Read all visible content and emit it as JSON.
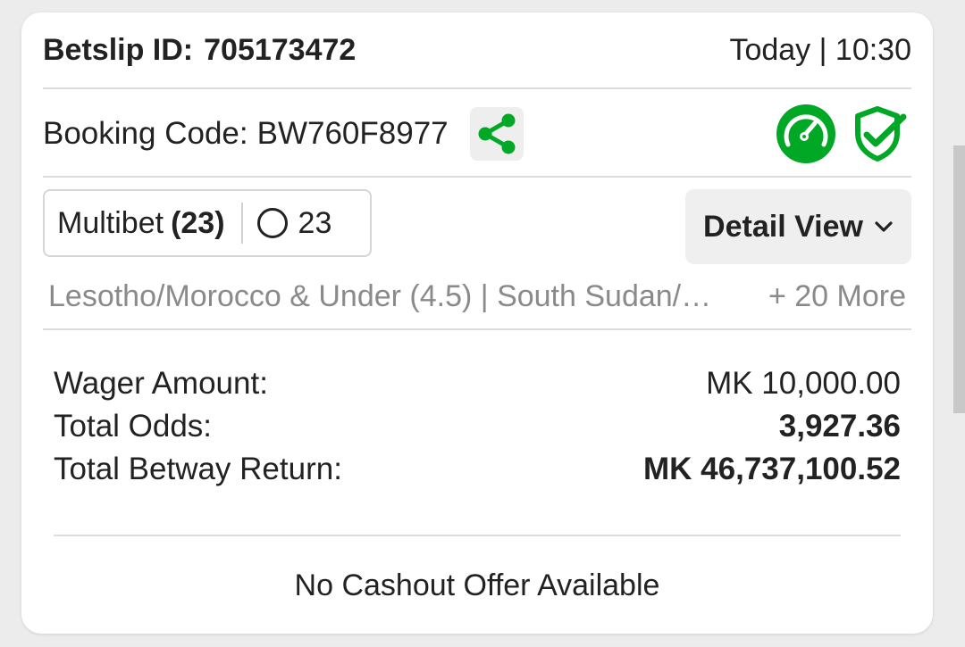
{
  "header": {
    "betslip_label": "Betslip ID:",
    "betslip_id": "705173472",
    "datetime": "Today | 10:30"
  },
  "booking": {
    "label": "Booking Code:",
    "code": "BW760F8977",
    "share_icon": "share-icon",
    "status_icons": [
      "speedometer-icon",
      "shield-check-icon"
    ]
  },
  "bet_type": {
    "label": "Multibet",
    "count": "(23)",
    "circle_count": "23"
  },
  "detail_view": {
    "label": "Detail View"
  },
  "selections": {
    "summary": "Lesotho/Morocco & Under (4.5) | South Sudan/…",
    "more": "+ 20 More"
  },
  "summary": {
    "wager_label": "Wager Amount:",
    "wager_value": "MK 10,000.00",
    "odds_label": "Total Odds:",
    "odds_value": "3,927.36",
    "return_label": "Total Betway Return:",
    "return_value": "MK 46,737,100.52"
  },
  "cashout": {
    "message": "No Cashout Offer Available"
  },
  "colors": {
    "accent_green": "#00a826",
    "card_bg": "#ffffff",
    "page_bg": "#ececec",
    "muted_text": "#8a8a8a"
  }
}
